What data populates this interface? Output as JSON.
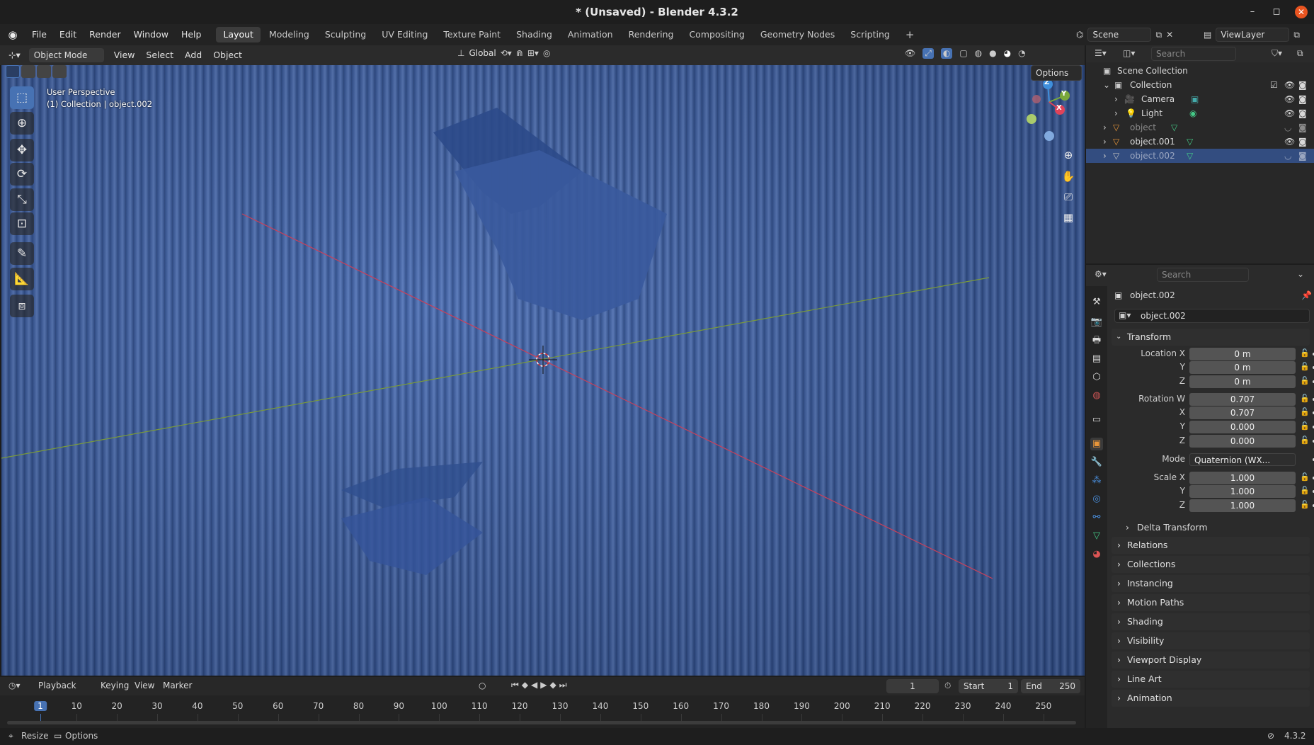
{
  "window": {
    "title": "* (Unsaved) - Blender 4.3.2",
    "controls": [
      "–",
      "◻",
      "✕"
    ]
  },
  "menu": {
    "items": [
      "File",
      "Edit",
      "Render",
      "Window",
      "Help"
    ]
  },
  "workspaces": [
    "Layout",
    "Modeling",
    "Sculpting",
    "UV Editing",
    "Texture Paint",
    "Shading",
    "Animation",
    "Rendering",
    "Compositing",
    "Geometry Nodes",
    "Scripting"
  ],
  "workspace_active": "Layout",
  "scene": {
    "name": "Scene",
    "view_layer": "ViewLayer"
  },
  "viewport": {
    "mode": "Object Mode",
    "menus": [
      "View",
      "Select",
      "Add",
      "Object"
    ],
    "orientation": "Global",
    "options_label": "Options",
    "overlay_text_line1": "User Perspective",
    "overlay_text_line2": "(1) Collection | object.002",
    "gizmo_axes": {
      "x": "X",
      "y": "Y",
      "z": "Z"
    }
  },
  "outliner": {
    "search_placeholder": "Search",
    "rows": [
      {
        "label": "Scene Collection"
      },
      {
        "label": "Collection"
      },
      {
        "label": "Camera"
      },
      {
        "label": "Light"
      },
      {
        "label": "object"
      },
      {
        "label": "object.001"
      },
      {
        "label": "object.002"
      }
    ]
  },
  "properties": {
    "search_placeholder": "Search",
    "object_name": "object.002",
    "object_datablock": "object.002",
    "transform_label": "Transform",
    "location": {
      "label_x": "Location X",
      "label_y": "Y",
      "label_z": "Z",
      "x": "0 m",
      "y": "0 m",
      "z": "0 m"
    },
    "rotation": {
      "label_w": "Rotation W",
      "label_x": "X",
      "label_y": "Y",
      "label_z": "Z",
      "w": "0.707",
      "x": "0.707",
      "y": "0.000",
      "z": "0.000"
    },
    "mode": {
      "label": "Mode",
      "value": "Quaternion (WX..."
    },
    "scale": {
      "label_x": "Scale X",
      "label_y": "Y",
      "label_z": "Z",
      "x": "1.000",
      "y": "1.000",
      "z": "1.000"
    },
    "delta_transform": "Delta Transform",
    "sections": [
      "Relations",
      "Collections",
      "Instancing",
      "Motion Paths",
      "Shading",
      "Visibility",
      "Viewport Display",
      "Line Art",
      "Animation"
    ]
  },
  "timeline": {
    "menus": [
      "Playback",
      "Keying",
      "View",
      "Marker"
    ],
    "current_frame": "1",
    "start_label": "Start",
    "start": "1",
    "end_label": "End",
    "end": "250",
    "ticks": [
      "1",
      "10",
      "20",
      "30",
      "40",
      "50",
      "60",
      "70",
      "80",
      "90",
      "100",
      "110",
      "120",
      "130",
      "140",
      "150",
      "160",
      "170",
      "180",
      "190",
      "200",
      "210",
      "220",
      "230",
      "240",
      "250"
    ]
  },
  "status": {
    "resize": "Resize",
    "options": "Options",
    "version": "4.3.2"
  },
  "colors": {
    "accent": "#4772b3",
    "selected_row": "#334d80",
    "x_axis": "#c8405a",
    "y_axis": "#7a9a3a",
    "z_axis": "#3f8fdc",
    "close_button": "#e95420"
  }
}
